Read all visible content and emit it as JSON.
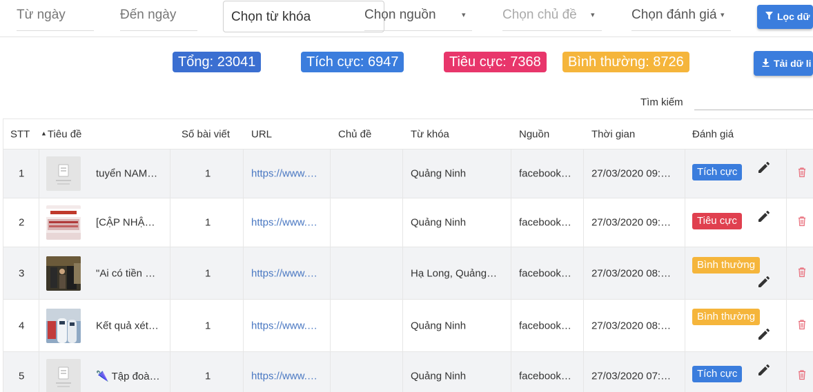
{
  "filters": {
    "from_date": "Từ ngày",
    "to_date": "Đến ngày",
    "keyword": "Chọn từ khóa",
    "source": "Chọn nguồn",
    "topic": "Chọn chủ đề",
    "rating": "Chọn đánh giá",
    "filter_button": "Lọc dữ",
    "arrow": "▾"
  },
  "stats": {
    "total": "Tổng: 23041",
    "positive": "Tích cực: 6947",
    "negative": "Tiêu cực: 7368",
    "neutral": "Bình thường: 8726",
    "download_button": "Tải dữ li"
  },
  "search": {
    "label": "Tìm kiếm",
    "value": ""
  },
  "colors": {
    "blue": "#3b7ddd",
    "negative": "#e8366b",
    "neutral": "#f5b53b",
    "badge_negative": "#e0404f"
  },
  "table": {
    "headers": {
      "stt": "STT",
      "title": "Tiêu đề",
      "posts": "Số bài viết",
      "url": "URL",
      "topic": "Chủ đề",
      "keyword": "Từ khóa",
      "source": "Nguồn",
      "time": "Thời gian",
      "rating": "Đánh giá"
    },
    "rows": [
      {
        "stt": "1",
        "title": "tuyển NAM…",
        "posts": "1",
        "url": "https://www.…",
        "topic": "",
        "keyword": "Quảng Ninh",
        "source": "facebook…",
        "time": "27/03/2020 09:…",
        "rating": "Tích cực",
        "thumb": "placeholder"
      },
      {
        "stt": "2",
        "title": "[CẬP NHẬ…",
        "posts": "1",
        "url": "https://www.…",
        "topic": "",
        "keyword": "Quảng Ninh",
        "source": "facebook…",
        "time": "27/03/2020 09:…",
        "rating": "Tiêu cực",
        "thumb": "covid"
      },
      {
        "stt": "3",
        "title": "\"Ai có tiền …",
        "posts": "1",
        "url": "https://www.…",
        "topic": "",
        "keyword": "Hạ Long, Quảng…",
        "source": "facebook…",
        "time": "27/03/2020 08:…",
        "rating": "Bình thường",
        "thumb": "photo-dark"
      },
      {
        "stt": "4",
        "title": "Kết quả xét…",
        "posts": "1",
        "url": "https://www.…",
        "topic": "",
        "keyword": "Quảng Ninh",
        "source": "facebook…",
        "time": "27/03/2020 08:…",
        "rating": "Bình thường",
        "thumb": "photo-medical"
      },
      {
        "stt": "5",
        "title": "🌂 Tập đoà…",
        "posts": "1",
        "url": "https://www.…",
        "topic": "",
        "keyword": "Quảng Ninh",
        "source": "facebook…",
        "time": "27/03/2020 07:…",
        "rating": "Tích cực",
        "thumb": "placeholder"
      }
    ]
  }
}
